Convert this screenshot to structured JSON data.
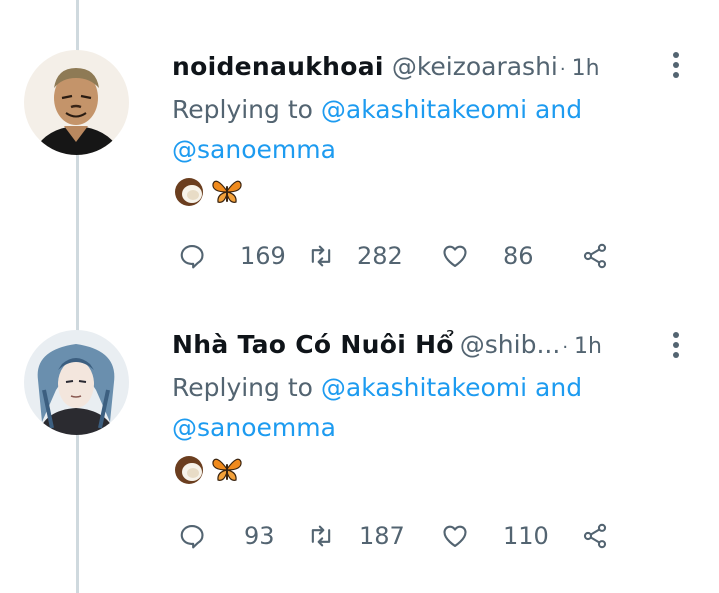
{
  "tweets": [
    {
      "name": "noidenaukhoai",
      "handle": "@keizoarashi",
      "separator": "·",
      "time": "1h",
      "replying_label": "Replying to",
      "mention1": "@akashitakeomi",
      "and_label": "and",
      "mention2": "@sanoemma",
      "emojis": [
        "coconut-emoji",
        "butterfly-emoji"
      ],
      "replies": "169",
      "retweets": "282",
      "likes": "86"
    },
    {
      "name": "Nhà Tao Có Nuôi Hổ",
      "handle": "@shib...",
      "separator": "·",
      "time": "1h",
      "replying_label": "Replying to",
      "mention1": "@akashitakeomi",
      "and_label": "and",
      "mention2": "@sanoemma",
      "emojis": [
        "coconut-emoji",
        "butterfly-emoji"
      ],
      "replies": "93",
      "retweets": "187",
      "likes": "110"
    }
  ],
  "colors": {
    "text": "#0f1419",
    "muted": "#536471",
    "link": "#1d9bf0",
    "thread_line": "#cfd9de"
  },
  "icons": [
    "reply-icon",
    "retweet-icon",
    "like-icon",
    "share-icon",
    "more-icon"
  ]
}
